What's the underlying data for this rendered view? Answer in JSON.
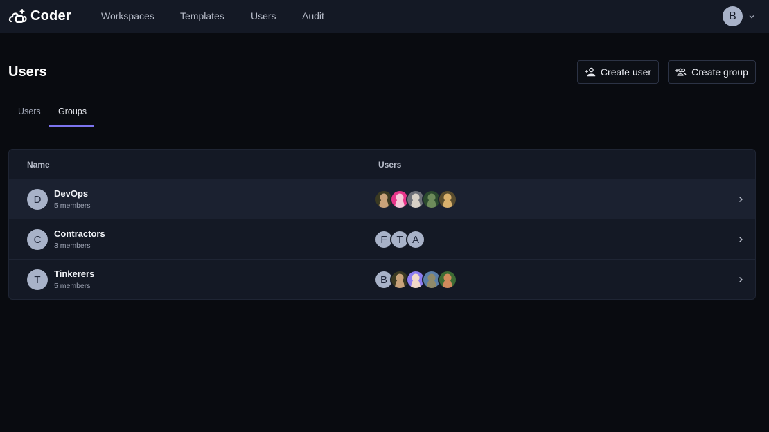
{
  "app": {
    "name": "Coder"
  },
  "nav": {
    "links": [
      "Workspaces",
      "Templates",
      "Users",
      "Audit"
    ],
    "user_initial": "B"
  },
  "page": {
    "title": "Users",
    "create_user_label": "Create user",
    "create_group_label": "Create group"
  },
  "tabs": [
    {
      "label": "Users",
      "active": false
    },
    {
      "label": "Groups",
      "active": true
    }
  ],
  "table": {
    "columns": [
      "Name",
      "Users"
    ],
    "rows": [
      {
        "initial": "D",
        "name": "DevOps",
        "members": "5 members",
        "avatars": [
          {
            "type": "photo",
            "colors": [
              "#3b3a22",
              "#c9a27a"
            ]
          },
          {
            "type": "photo",
            "colors": [
              "#e8358a",
              "#f5c7d8"
            ]
          },
          {
            "type": "photo",
            "colors": [
              "#6c6f78",
              "#d7d0c6"
            ]
          },
          {
            "type": "photo",
            "colors": [
              "#2b4a2e",
              "#6d8b5a"
            ]
          },
          {
            "type": "photo",
            "colors": [
              "#5a4d2e",
              "#d9b06c"
            ]
          }
        ]
      },
      {
        "initial": "C",
        "name": "Contractors",
        "members": "3 members",
        "avatars": [
          {
            "type": "initial",
            "text": "F"
          },
          {
            "type": "initial",
            "text": "T"
          },
          {
            "type": "initial",
            "text": "A"
          }
        ]
      },
      {
        "initial": "T",
        "name": "Tinkerers",
        "members": "5 members",
        "avatars": [
          {
            "type": "initial",
            "text": "B"
          },
          {
            "type": "photo",
            "colors": [
              "#3b3a22",
              "#c9a27a"
            ]
          },
          {
            "type": "photo",
            "colors": [
              "#8c7cf0",
              "#f1d9c8"
            ]
          },
          {
            "type": "photo",
            "colors": [
              "#5b7fa8",
              "#8f8a6a"
            ]
          },
          {
            "type": "photo",
            "colors": [
              "#3d6b34",
              "#d08a5c"
            ]
          }
        ]
      }
    ]
  }
}
